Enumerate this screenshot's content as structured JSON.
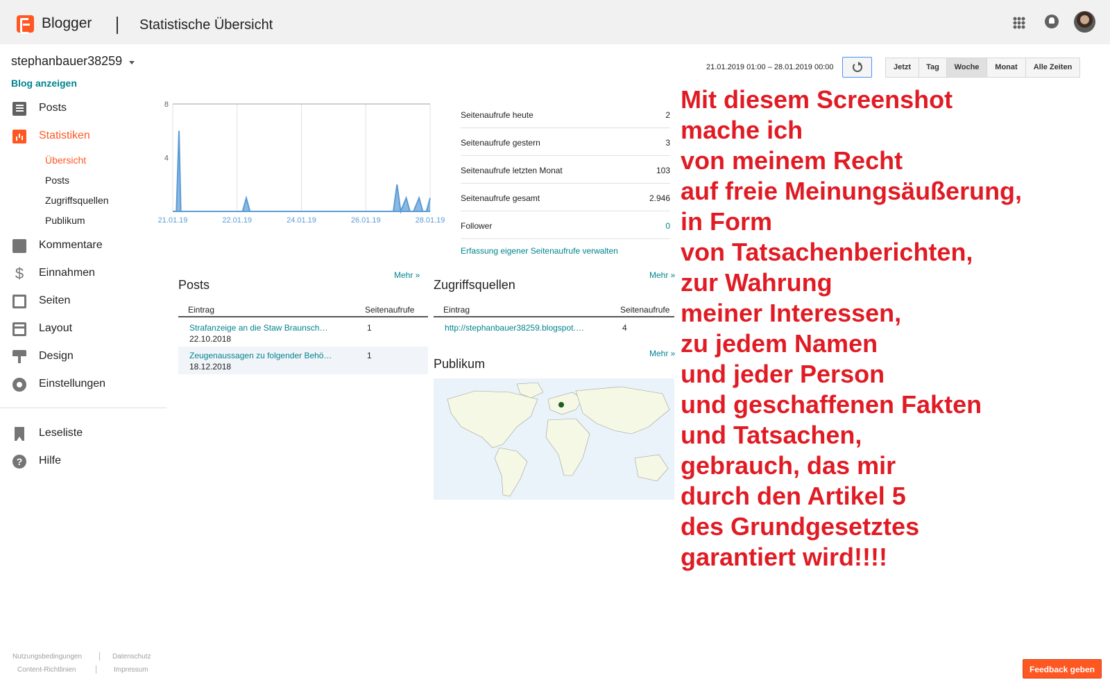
{
  "header": {
    "brand": "Blogger",
    "page_title": "Statistische Übersicht"
  },
  "sidebar": {
    "blog_name": "stephanbauer38259",
    "blog_link": "Blog anzeigen",
    "nav": [
      {
        "label": "Posts",
        "icon": "posts-icon"
      },
      {
        "label": "Statistiken",
        "icon": "stats-icon"
      },
      {
        "label": "Kommentare",
        "icon": "comment-icon"
      },
      {
        "label": "Einnahmen",
        "icon": "dollar-icon"
      },
      {
        "label": "Seiten",
        "icon": "pages-icon"
      },
      {
        "label": "Layout",
        "icon": "layout-icon"
      },
      {
        "label": "Design",
        "icon": "paint-roller-icon"
      },
      {
        "label": "Einstellungen",
        "icon": "gear-icon"
      }
    ],
    "sub_nav": [
      "Übersicht",
      "Posts",
      "Zugriffsquellen",
      "Publikum"
    ],
    "nav_bottom": [
      {
        "label": "Leseliste",
        "icon": "bookmark-icon"
      },
      {
        "label": "Hilfe",
        "icon": "help-icon"
      }
    ],
    "footer": [
      "Nutzungsbedingungen",
      "Datenschutz",
      "Content-Richtlinien",
      "Impressum"
    ]
  },
  "toolbar": {
    "date_range": "21.01.2019 01:00 – 28.01.2019 00:00",
    "periods": [
      "Jetzt",
      "Tag",
      "Woche",
      "Monat",
      "Alle Zeiten"
    ],
    "active_period": "Woche"
  },
  "chart_data": {
    "type": "line",
    "x_labels": [
      "21.01.19",
      "22.01.19",
      "24.01.19",
      "26.01.19",
      "28.01.19"
    ],
    "y_ticks": [
      4,
      8
    ],
    "ylim": [
      0,
      8
    ],
    "x": [
      0,
      0.1,
      0.17,
      0.22,
      1.9,
      2.0,
      2.1,
      6.0,
      6.1,
      6.2,
      6.35,
      6.45,
      6.55,
      6.7,
      6.8,
      6.9,
      7.0
    ],
    "y": [
      0,
      0,
      6,
      0,
      0,
      1,
      0,
      0,
      2,
      0,
      1,
      0,
      0,
      1,
      0,
      0,
      1
    ],
    "color": "#5b9bd5"
  },
  "stats": [
    {
      "label": "Seitenaufrufe heute",
      "value": "2"
    },
    {
      "label": "Seitenaufrufe gestern",
      "value": "3"
    },
    {
      "label": "Seitenaufrufe letzten Monat",
      "value": "103"
    },
    {
      "label": "Seitenaufrufe gesamt",
      "value": "2.946"
    },
    {
      "label": "Follower",
      "value": "0"
    }
  ],
  "stats_manage_link": "Erfassung eigener Seitenaufrufe verwalten",
  "posts_card": {
    "title": "Posts",
    "more": "Mehr »",
    "col1": "Eintrag",
    "col2": "Seitenaufrufe",
    "rows": [
      {
        "title": "Strafanzeige an die Staw Braunsch…",
        "date": "22.10.2018",
        "views": "1"
      },
      {
        "title": "Zeugenaussagen zu folgender Behö…",
        "date": "18.12.2018",
        "views": "1"
      }
    ]
  },
  "sources_card": {
    "title": "Zugriffsquellen",
    "more": "Mehr »",
    "col1": "Eintrag",
    "col2": "Seitenaufrufe",
    "rows": [
      {
        "title": "http://stephanbauer38259.blogspot.…",
        "views": "4"
      }
    ]
  },
  "audience_card": {
    "title": "Publikum",
    "more": "Mehr »"
  },
  "overlay_lines": [
    "Mit diesem Screenshot",
    "mache ich",
    "von meinem Recht",
    "auf freie Meinungsäußerung,",
    "in Form",
    "von Tatsachenberichten,",
    "zur Wahrung",
    "meiner Interessen,",
    "zu jedem Namen",
    "und jeder Person",
    "und geschaffenen Fakten",
    "und Tatsachen,",
    "gebrauch, das mir",
    "durch den Artikel 5",
    "des Grundgesetztes",
    "garantiert wird!!!!"
  ],
  "feedback": "Feedback geben"
}
